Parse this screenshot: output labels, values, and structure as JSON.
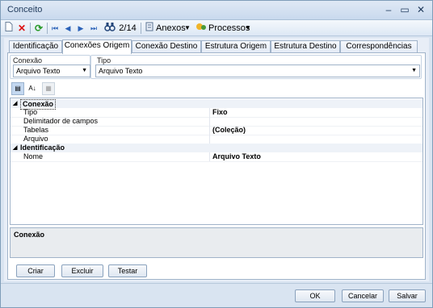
{
  "window": {
    "title": "Conceito",
    "controls": [
      "–",
      "▭",
      "✕"
    ]
  },
  "toolbar": {
    "nav_counter": "2/14",
    "anexos_label": "Anexos",
    "processos_label": "Processos"
  },
  "tabs": [
    {
      "label": "Identificação",
      "active": false
    },
    {
      "label": "Conexões Origem",
      "active": true
    },
    {
      "label": "Conexão Destino",
      "active": false
    },
    {
      "label": "Estrutura Origem",
      "active": false
    },
    {
      "label": "Estrutura Destino",
      "active": false
    },
    {
      "label": "Correspondências",
      "active": false
    }
  ],
  "conexao": {
    "label": "Conexão",
    "value": "Arquivo Texto"
  },
  "tipo": {
    "label": "Tipo",
    "value": "Arquivo Texto"
  },
  "property_grid": {
    "categories": [
      {
        "name": "Conexão",
        "rows": [
          {
            "name": "Tipo",
            "value": "Fixo"
          },
          {
            "name": "Delimitador de campos",
            "value": ""
          },
          {
            "name": "Tabelas",
            "value": "(Coleção)"
          },
          {
            "name": "Arquivo",
            "value": ""
          }
        ]
      },
      {
        "name": "Identificação",
        "rows": [
          {
            "name": "Nome",
            "value": "Arquivo Texto"
          }
        ]
      }
    ],
    "description_title": "Conexão"
  },
  "panel_buttons": {
    "criar": "Criar",
    "excluir": "Excluir",
    "testar": "Testar"
  },
  "footer_buttons": {
    "ok": "OK",
    "cancelar": "Cancelar",
    "salvar": "Salvar"
  },
  "colors": {
    "chrome": "#d9e4f1",
    "border": "#a0b3c9",
    "accent": "#1e395b"
  }
}
